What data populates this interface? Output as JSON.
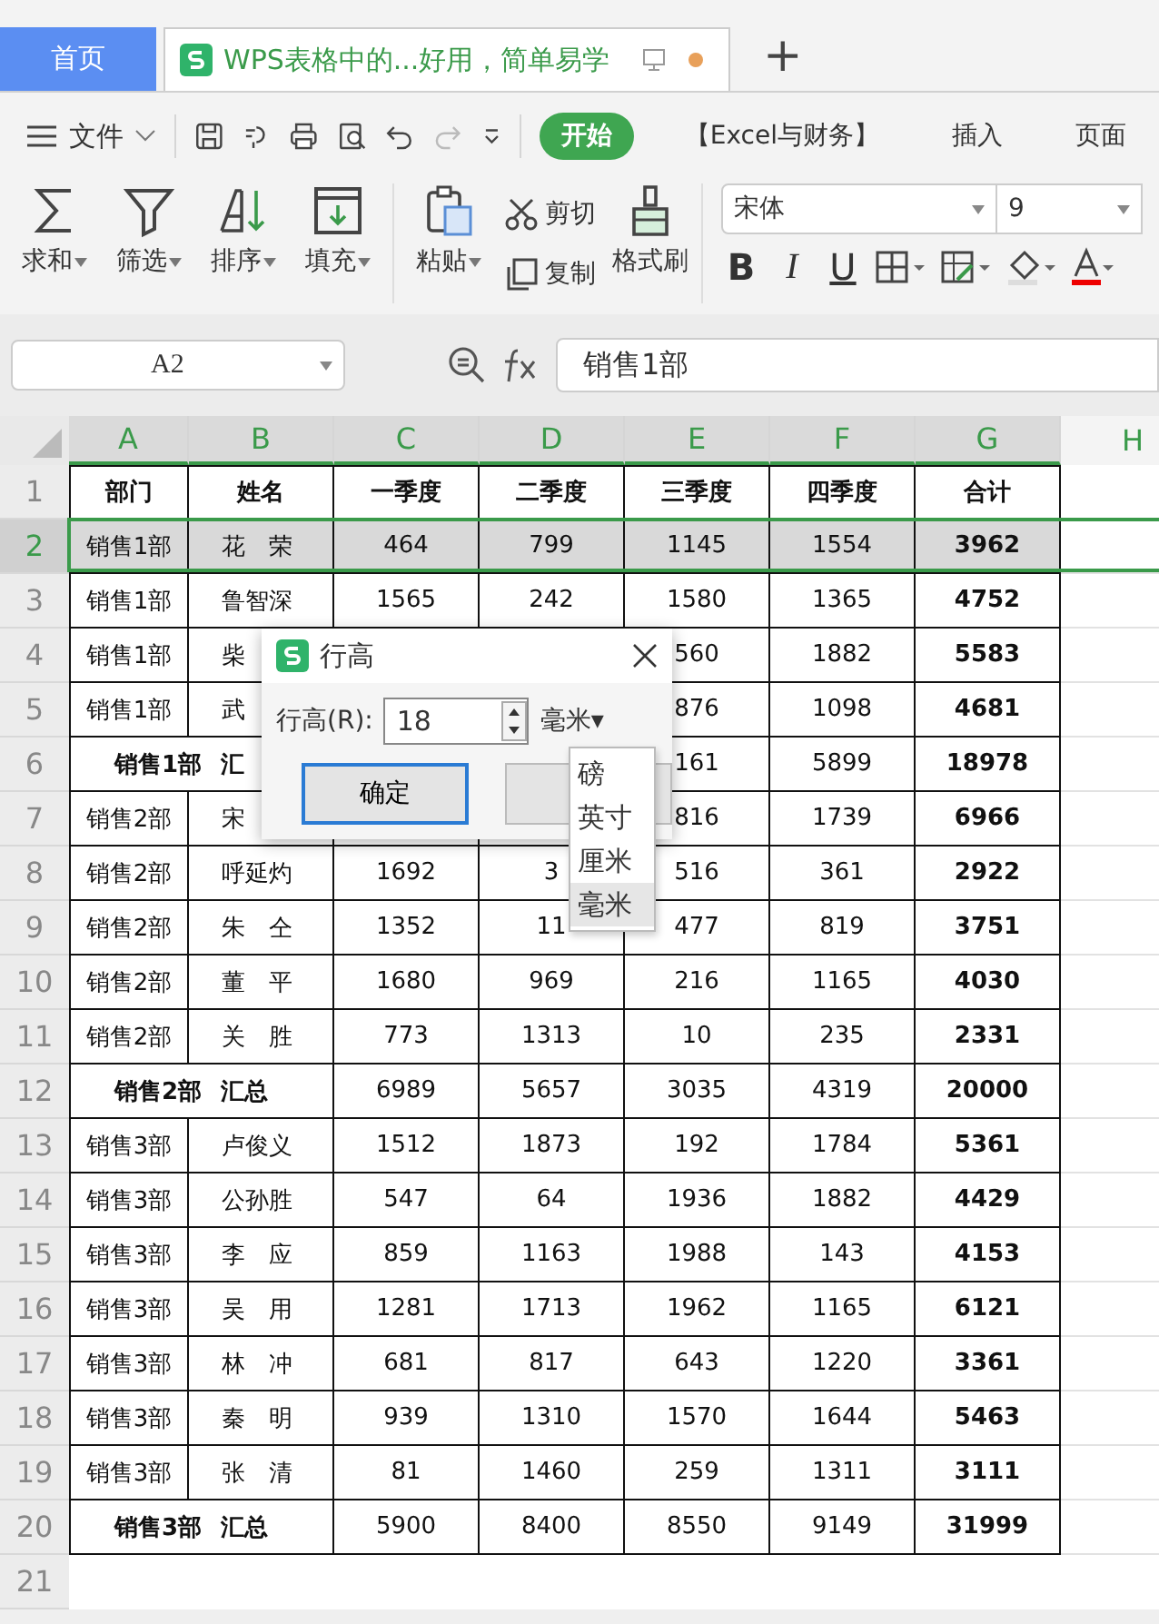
{
  "tabs": [
    {
      "label": "首页",
      "kind": "home",
      "selected": false
    },
    {
      "label": "WPS表格中的...好用，简单易学",
      "kind": "doc",
      "selected": true,
      "modified": true
    }
  ],
  "new_tab": "+",
  "file_menu": "文件",
  "menu_tabs": [
    {
      "label": "开始",
      "selected": true
    },
    {
      "label": "【Excel与财务】",
      "selected": false
    },
    {
      "label": "插入",
      "selected": false
    },
    {
      "label": "页面",
      "selected": false
    }
  ],
  "ribbon_tools": [
    {
      "label": "求和",
      "kind": "large",
      "dropdown": true
    },
    {
      "label": "筛选",
      "kind": "large",
      "dropdown": true
    },
    {
      "label": "排序",
      "kind": "large",
      "dropdown": true
    },
    {
      "label": "填充",
      "kind": "large",
      "dropdown": true
    },
    {
      "label": "粘贴",
      "kind": "large",
      "dropdown": true
    },
    {
      "label": "剪切",
      "kind": "small",
      "dropdown": false
    },
    {
      "label": "复制",
      "kind": "small",
      "dropdown": false
    },
    {
      "label": "格式刷",
      "kind": "large",
      "dropdown": false
    }
  ],
  "font": {
    "name": "宋体",
    "size": "9"
  },
  "format_buttons": [
    "B",
    "I",
    "U"
  ],
  "name_box": "A2",
  "formula": "销售1部",
  "columns": [
    {
      "label": "A",
      "selected": true
    },
    {
      "label": "B",
      "selected": true
    },
    {
      "label": "C",
      "selected": true
    },
    {
      "label": "D",
      "selected": true
    },
    {
      "label": "E",
      "selected": true
    },
    {
      "label": "F",
      "selected": true
    },
    {
      "label": "G",
      "selected": true
    },
    {
      "label": "H",
      "selected": false
    }
  ],
  "rows": [
    {
      "number": "1",
      "kind": "header",
      "selected": false,
      "cells": {
        "A": "部门",
        "B": "姓名",
        "C": "一季度",
        "D": "二季度",
        "E": "三季度",
        "F": "四季度",
        "G": "合计"
      }
    },
    {
      "number": "2",
      "kind": "data",
      "selected": true,
      "cells": {
        "A": "销售1部",
        "B": "花　荣",
        "C": "464",
        "D": "799",
        "E": "1145",
        "F": "1554",
        "G": "3962"
      }
    },
    {
      "number": "3",
      "kind": "data",
      "selected": false,
      "cells": {
        "A": "销售1部",
        "B": "鲁智深",
        "C": "1565",
        "D": "242",
        "E": "1580",
        "F": "1365",
        "G": "4752"
      }
    },
    {
      "number": "4",
      "kind": "data",
      "selected": false,
      "cells": {
        "A": "销售1部",
        "B": "柴",
        "E": "560",
        "F": "1882",
        "G": "5583"
      }
    },
    {
      "number": "5",
      "kind": "data",
      "selected": false,
      "cells": {
        "A": "销售1部",
        "B": "武",
        "E": "876",
        "F": "1098",
        "G": "4681"
      }
    },
    {
      "number": "6",
      "kind": "summary",
      "selected": false,
      "cells": {
        "A": "销售1部 汇",
        "E": "161",
        "F": "5899",
        "G": "18978"
      }
    },
    {
      "number": "7",
      "kind": "data",
      "selected": false,
      "cells": {
        "A": "销售2部",
        "B": "宋",
        "E": "816",
        "F": "1739",
        "G": "6966"
      }
    },
    {
      "number": "8",
      "kind": "data",
      "selected": false,
      "cells": {
        "A": "销售2部",
        "B": "呼延灼",
        "C": "1692",
        "D": "3",
        "E": "516",
        "F": "361",
        "G": "2922"
      }
    },
    {
      "number": "9",
      "kind": "data",
      "selected": false,
      "cells": {
        "A": "销售2部",
        "B": "朱　仝",
        "C": "1352",
        "D": "11",
        "E": "477",
        "F": "819",
        "G": "3751"
      }
    },
    {
      "number": "10",
      "kind": "data",
      "selected": false,
      "cells": {
        "A": "销售2部",
        "B": "董　平",
        "C": "1680",
        "D": "969",
        "E": "216",
        "F": "1165",
        "G": "4030"
      }
    },
    {
      "number": "11",
      "kind": "data",
      "selected": false,
      "cells": {
        "A": "销售2部",
        "B": "关　胜",
        "C": "773",
        "D": "1313",
        "E": "10",
        "F": "235",
        "G": "2331"
      }
    },
    {
      "number": "12",
      "kind": "summary",
      "selected": false,
      "cells": {
        "A": "销售2部 汇总",
        "C": "6989",
        "D": "5657",
        "E": "3035",
        "F": "4319",
        "G": "20000"
      }
    },
    {
      "number": "13",
      "kind": "data",
      "selected": false,
      "cells": {
        "A": "销售3部",
        "B": "卢俊义",
        "C": "1512",
        "D": "1873",
        "E": "192",
        "F": "1784",
        "G": "5361"
      }
    },
    {
      "number": "14",
      "kind": "data",
      "selected": false,
      "cells": {
        "A": "销售3部",
        "B": "公孙胜",
        "C": "547",
        "D": "64",
        "E": "1936",
        "F": "1882",
        "G": "4429"
      }
    },
    {
      "number": "15",
      "kind": "data",
      "selected": false,
      "cells": {
        "A": "销售3部",
        "B": "李　应",
        "C": "859",
        "D": "1163",
        "E": "1988",
        "F": "143",
        "G": "4153"
      }
    },
    {
      "number": "16",
      "kind": "data",
      "selected": false,
      "cells": {
        "A": "销售3部",
        "B": "吴　用",
        "C": "1281",
        "D": "1713",
        "E": "1962",
        "F": "1165",
        "G": "6121"
      }
    },
    {
      "number": "17",
      "kind": "data",
      "selected": false,
      "cells": {
        "A": "销售3部",
        "B": "林　冲",
        "C": "681",
        "D": "817",
        "E": "643",
        "F": "1220",
        "G": "3361"
      }
    },
    {
      "number": "18",
      "kind": "data",
      "selected": false,
      "cells": {
        "A": "销售3部",
        "B": "秦　明",
        "C": "939",
        "D": "1310",
        "E": "1570",
        "F": "1644",
        "G": "5463"
      }
    },
    {
      "number": "19",
      "kind": "data",
      "selected": false,
      "cells": {
        "A": "销售3部",
        "B": "张　清",
        "C": "81",
        "D": "1460",
        "E": "259",
        "F": "1311",
        "G": "3111"
      }
    },
    {
      "number": "20",
      "kind": "summary",
      "selected": false,
      "cells": {
        "A": "销售3部 汇总",
        "C": "5900",
        "D": "8400",
        "E": "8550",
        "F": "9149",
        "G": "31999"
      }
    },
    {
      "number": "21",
      "kind": "empty",
      "selected": false,
      "cells": {}
    }
  ],
  "dialog": {
    "title": "行高",
    "label": "行高(R):",
    "value": "18",
    "unit": "毫米▾",
    "ok": "确定",
    "unit_options": [
      {
        "label": "磅",
        "selected": false
      },
      {
        "label": "英寸",
        "selected": false
      },
      {
        "label": "厘米",
        "selected": false
      },
      {
        "label": "毫米",
        "selected": true
      }
    ]
  }
}
